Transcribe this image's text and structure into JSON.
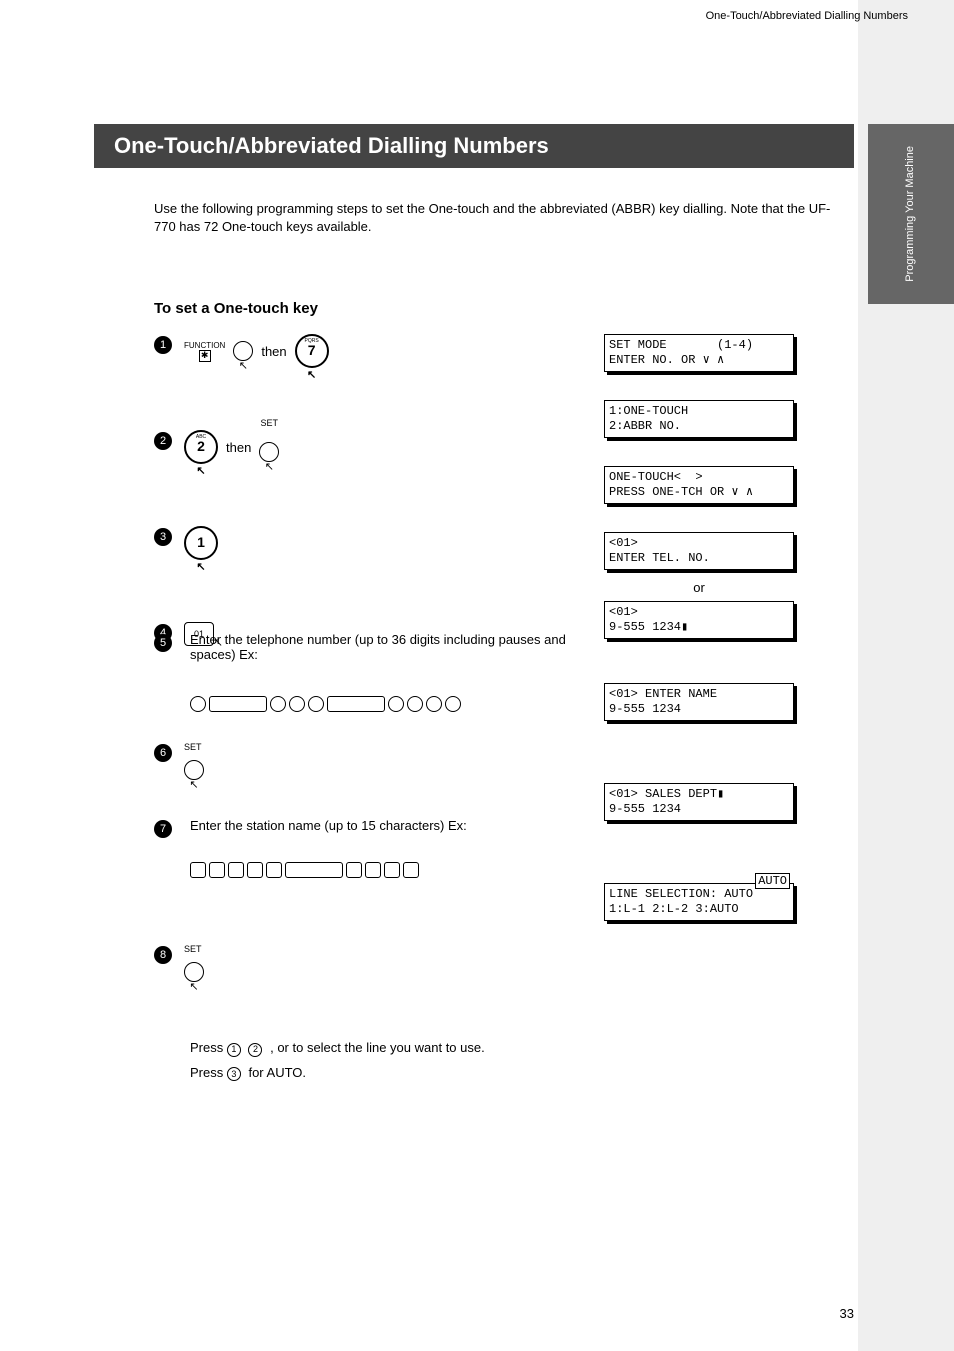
{
  "header": {
    "page_top_info": "One-Touch/Abbreviated Dialling Numbers",
    "title": "One-Touch/Abbreviated Dialling Numbers",
    "side_tab": "Programming\nYour Machine",
    "intro": "Use the following programming steps to set the One-touch and the abbreviated (ABBR) key dialling.\nNote that the UF-770 has 72 One-touch keys available.",
    "subhead": "To set a One-touch key"
  },
  "steps": {
    "s1_then": "then",
    "s2_then": "then",
    "s5_label": "Enter the telephone number\n(up to 36 digits including pauses and spaces)\nEx:",
    "s7_label": "Enter the station name (up to 15 characters)\nEx:",
    "choice_line1": " ,    or    to select the line you want to use.",
    "choice_line2": "     for AUTO."
  },
  "keys": {
    "function_label": "FUNCTION",
    "key7_top": "PQRS",
    "key7": "7",
    "key2_top": "ABC",
    "key2": "2",
    "key1": "1",
    "set_label": "SET",
    "btn01": "01",
    "row5": [
      "c",
      "w",
      "c",
      "c",
      "c",
      "w",
      "c",
      "c",
      "c",
      "c"
    ],
    "row7": [
      "r",
      "r",
      "r",
      "r",
      "r",
      "w",
      "r",
      "r",
      "r",
      "r"
    ],
    "circ1": "1",
    "circ2": "2",
    "circ3": "3"
  },
  "lcd": {
    "d1": "SET MODE       (1-4)\nENTER NO. OR ∨ ∧",
    "d2": "1:ONE-TOUCH\n2:ABBR NO.",
    "d3": "ONE-TOUCH<  >\nPRESS ONE-TCH OR ∨ ∧",
    "d4": "<01>\nENTER TEL. NO.",
    "d4b_or": "or",
    "d4b": "<01>\n9-555 1234▮",
    "d6": "<01> ENTER NAME\n9-555 1234",
    "d7": "<01> SALES DEPT▮\n9-555 1234",
    "d8": "LINE SELECTION: AUTO\n1:L-1 2:L-2 3:AUTO",
    "d8_box": "AUTO"
  },
  "footer": {
    "page": "33"
  }
}
